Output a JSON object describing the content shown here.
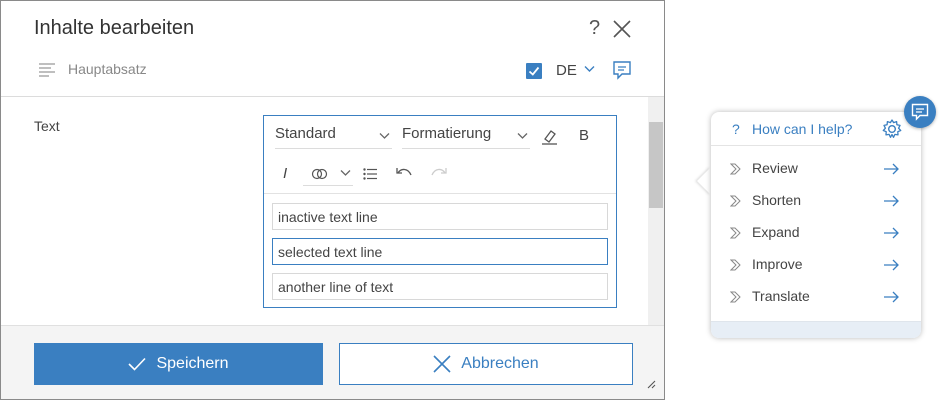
{
  "dialog": {
    "title": "Inhalte bearbeiten",
    "help_label": "?",
    "subtitle": "Hauptabsatz",
    "language": "DE",
    "checkbox_checked": true
  },
  "field": {
    "label": "Text"
  },
  "editor": {
    "style_select": "Standard",
    "format_select": "Formatierung",
    "bold_label": "B",
    "italic_label": "I",
    "lines": [
      "inactive text line",
      "selected text line",
      "another line of text"
    ]
  },
  "footer": {
    "save_label": "Speichern",
    "cancel_label": "Abbrechen"
  },
  "ai_panel": {
    "help_mark": "?",
    "title": "How can I help?",
    "items": [
      {
        "label": "Review"
      },
      {
        "label": "Shorten"
      },
      {
        "label": "Expand"
      },
      {
        "label": "Improve"
      },
      {
        "label": "Translate"
      }
    ]
  },
  "icons": {
    "close": "close-icon",
    "paragraph": "paragraph-icon",
    "comment": "comment-icon",
    "eraser": "eraser-icon",
    "link": "link-icon",
    "list": "bullet-list-icon",
    "undo": "undo-icon",
    "redo": "redo-icon",
    "check": "check-icon",
    "gear": "gear-icon",
    "arrow": "arrow-right-icon"
  },
  "colors": {
    "accent": "#3a7fc1",
    "panel_footer": "#e7eef6",
    "scrollbar_thumb": "#c6c6c6"
  }
}
